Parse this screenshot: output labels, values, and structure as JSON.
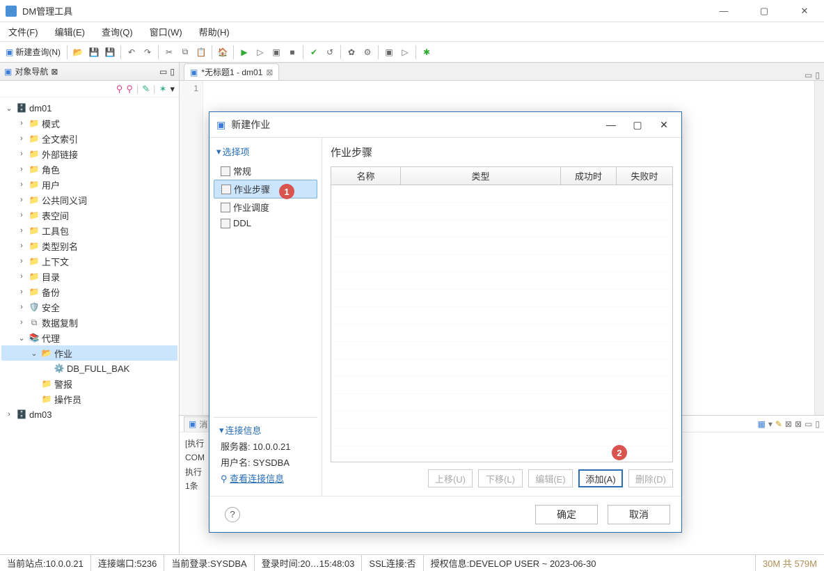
{
  "window": {
    "title": "DM管理工具"
  },
  "menus": {
    "file": "文件(F)",
    "edit": "编辑(E)",
    "query": "查询(Q)",
    "window": "窗口(W)",
    "help": "帮助(H)"
  },
  "toolbar": {
    "new_query": "新建查询(N)"
  },
  "nav": {
    "tab_label": "对象导航",
    "tree": [
      {
        "l": "dm01",
        "icon": "db",
        "indent": 0,
        "exp": true
      },
      {
        "l": "模式",
        "icon": "folder",
        "indent": 1
      },
      {
        "l": "全文索引",
        "icon": "folder",
        "indent": 1
      },
      {
        "l": "外部链接",
        "icon": "folder",
        "indent": 1
      },
      {
        "l": "角色",
        "icon": "folder",
        "indent": 1
      },
      {
        "l": "用户",
        "icon": "folder",
        "indent": 1
      },
      {
        "l": "公共同义词",
        "icon": "folder",
        "indent": 1
      },
      {
        "l": "表空间",
        "icon": "folder",
        "indent": 1
      },
      {
        "l": "工具包",
        "icon": "folder",
        "indent": 1
      },
      {
        "l": "类型别名",
        "icon": "folder",
        "indent": 1
      },
      {
        "l": "上下文",
        "icon": "folder",
        "indent": 1
      },
      {
        "l": "目录",
        "icon": "folder",
        "indent": 1
      },
      {
        "l": "备份",
        "icon": "folder",
        "indent": 1
      },
      {
        "l": "安全",
        "icon": "shield",
        "indent": 1
      },
      {
        "l": "数据复制",
        "icon": "copy",
        "indent": 1
      },
      {
        "l": "代理",
        "icon": "agent",
        "indent": 1,
        "exp": true
      },
      {
        "l": "作业",
        "icon": "folder-open",
        "indent": 2,
        "exp": true,
        "sel": true
      },
      {
        "l": "DB_FULL_BAK",
        "icon": "job",
        "indent": 3
      },
      {
        "l": "警报",
        "icon": "folder",
        "indent": 2
      },
      {
        "l": "操作员",
        "icon": "folder",
        "indent": 2
      },
      {
        "l": "dm03",
        "icon": "db",
        "indent": 0
      }
    ]
  },
  "editor": {
    "tab": "*无标题1 - dm01",
    "line": "1"
  },
  "bottom": {
    "tab": "消",
    "lines": [
      "[执行",
      "COM",
      "执行",
      "",
      "1条"
    ]
  },
  "dialog": {
    "title": "新建作业",
    "options_hdr": "选择项",
    "options": [
      "常规",
      "作业步骤",
      "作业调度",
      "DDL"
    ],
    "selected_option": 1,
    "conn_hdr": "连接信息",
    "conn_server_label": "服务器:",
    "conn_server": "10.0.0.21",
    "conn_user_label": "用户名:",
    "conn_user": "SYSDBA",
    "conn_view": "查看连接信息",
    "main_title": "作业步骤",
    "cols": [
      "名称",
      "类型",
      "成功时",
      "失败时"
    ],
    "actions": {
      "up": "上移(U)",
      "down": "下移(L)",
      "edit": "编辑(E)",
      "add": "添加(A)",
      "del": "删除(D)"
    },
    "ok": "确定",
    "cancel": "取消"
  },
  "callouts": {
    "one": "1",
    "two": "2"
  },
  "status": {
    "site": "当前站点:10.0.0.21",
    "port": "连接端口:5236",
    "login": "当前登录:SYSDBA",
    "time": "登录时间:20…15:48:03",
    "ssl": "SSL连接:否",
    "auth": "授权信息:DEVELOP USER ~ 2023-06-30",
    "mem": "30M 共 579M"
  }
}
